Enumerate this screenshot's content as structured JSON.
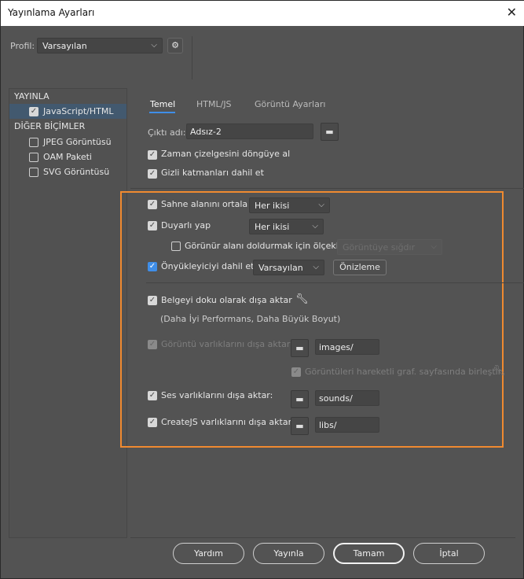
{
  "window": {
    "title": "Yayınlama Ayarları"
  },
  "profile": {
    "label": "Profil:",
    "value": "Varsayılan"
  },
  "sidebar": {
    "publish_header": "YAYINLA",
    "publish_items": [
      {
        "label": "JavaScript/HTML",
        "checked": true,
        "selected": true
      }
    ],
    "other_header": "DİĞER BİÇİMLER",
    "other_items": [
      {
        "label": "JPEG Görüntüsü",
        "checked": false
      },
      {
        "label": "OAM Paketi",
        "checked": false
      },
      {
        "label": "SVG Görüntüsü",
        "checked": false
      }
    ]
  },
  "tabs": [
    {
      "label": "Temel",
      "active": true
    },
    {
      "label": "HTML/JS"
    },
    {
      "label": "Görüntü Ayarları"
    }
  ],
  "output": {
    "label": "Çıktı adı:",
    "value": "Adsız-2"
  },
  "options": {
    "loop": "Zaman çizelgesini döngüye al",
    "hidden_layers": "Gizli katmanları dahil et",
    "center_stage": "Sahne alanını ortala",
    "center_stage_value": "Her ikisi",
    "responsive": "Duyarlı yap",
    "responsive_value": "Her ikisi",
    "scale": "Görünür alanı doldurmak için ölçekle",
    "scale_value": "Görüntüye sığdır",
    "preloader": "Önyükleyiciyi dahil et",
    "preloader_value": "Varsayılan",
    "preview_button": "Önizleme",
    "texture": "Belgeyi doku olarak dışa aktar",
    "texture_note": "(Daha İyi Performans, Daha Büyük Boyut)",
    "image_assets": "Görüntü varlıklarını dışa aktar:",
    "image_path": "images/",
    "spritesheet": "Görüntüleri hareketli graf. sayfasında birleştir",
    "sound_assets": "Ses varlıklarını dışa aktar:",
    "sound_path": "sounds/",
    "createjs_assets": "CreateJS varlıklarını dışa aktar:",
    "createjs_path": "libs/"
  },
  "buttons": {
    "help": "Yardım",
    "publish": "Yayınla",
    "ok": "Tamam",
    "cancel": "İptal"
  },
  "colors": {
    "highlight_box": "#f08a30",
    "accent": "#3f8ee8"
  }
}
